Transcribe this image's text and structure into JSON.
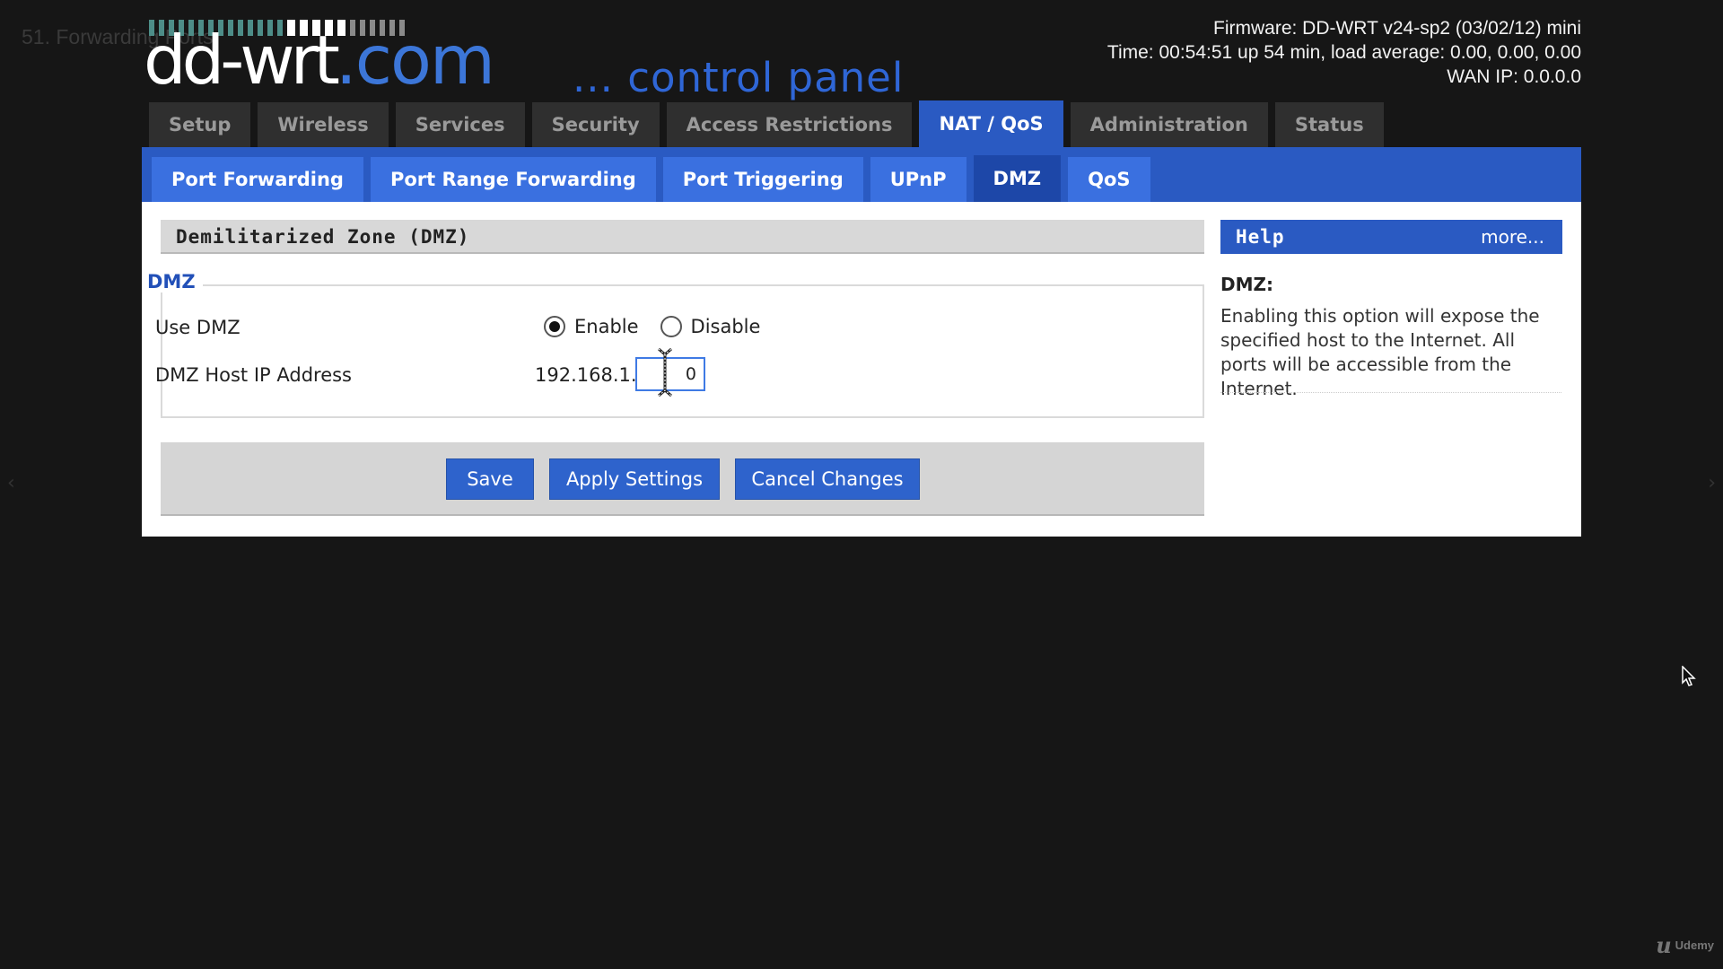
{
  "video": {
    "title": "51. Forwarding Ports"
  },
  "header": {
    "logo_main": "dd-wrt",
    "logo_domain": ".com",
    "panel_title": "... control panel",
    "firmware": "Firmware: DD-WRT v24-sp2 (03/02/12) mini",
    "time": "Time: 00:54:51 up 54 min, load average: 0.00, 0.00, 0.00",
    "wan_ip": "WAN IP: 0.0.0.0"
  },
  "main_tabs": [
    "Setup",
    "Wireless",
    "Services",
    "Security",
    "Access Restrictions",
    "NAT / QoS",
    "Administration",
    "Status"
  ],
  "main_tab_active": "NAT / QoS",
  "sub_tabs": [
    "Port Forwarding",
    "Port Range Forwarding",
    "Port Triggering",
    "UPnP",
    "DMZ",
    "QoS"
  ],
  "sub_tab_active": "DMZ",
  "section": {
    "title": "Demilitarized Zone (DMZ)",
    "legend": "DMZ",
    "use_dmz_label": "Use DMZ",
    "enable_label": "Enable",
    "disable_label": "Disable",
    "dmz_enabled": true,
    "host_ip_label": "DMZ Host IP Address",
    "ip_prefix": "192.168.1.",
    "ip_last_octet": "0"
  },
  "buttons": {
    "save": "Save",
    "apply": "Apply Settings",
    "cancel": "Cancel Changes"
  },
  "help": {
    "title": "Help",
    "more": "more...",
    "topic": "DMZ:",
    "text": "Enabling this option will expose the specified host to the Internet. All ports will be accessible from the Internet."
  },
  "player": {
    "prev_arrow": "‹",
    "next_arrow": "›",
    "brand": "Udemy"
  },
  "icons": {
    "signal": "signal-strength-icon",
    "text_cursor": "i-beam-cursor-icon",
    "mouse": "mouse-pointer-icon"
  }
}
